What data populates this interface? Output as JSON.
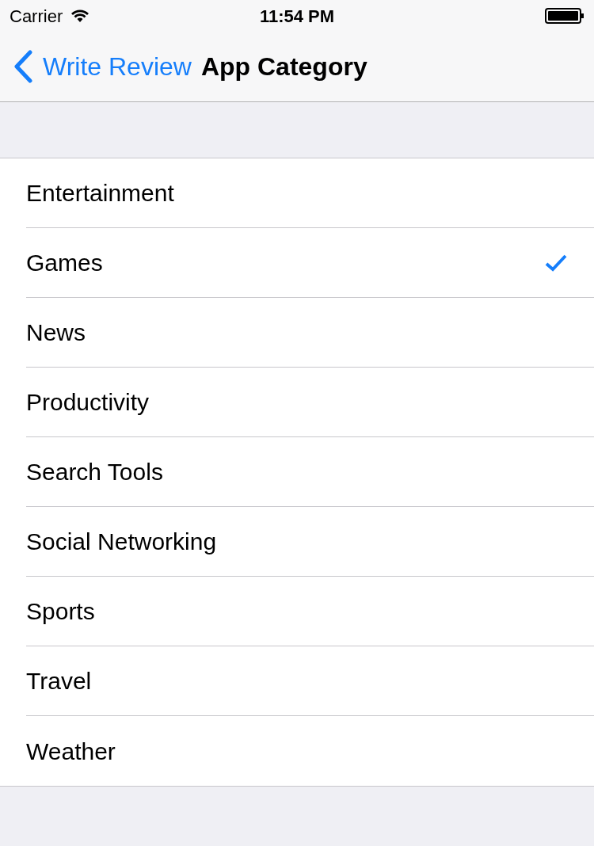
{
  "status_bar": {
    "carrier": "Carrier",
    "time": "11:54 PM"
  },
  "nav_bar": {
    "back": "Write Review",
    "title": "App Category"
  },
  "categories": [
    {
      "label": "Entertainment",
      "selected": false
    },
    {
      "label": "Games",
      "selected": true
    },
    {
      "label": "News",
      "selected": false
    },
    {
      "label": "Productivity",
      "selected": false
    },
    {
      "label": "Search Tools",
      "selected": false
    },
    {
      "label": "Social Networking",
      "selected": false
    },
    {
      "label": "Sports",
      "selected": false
    },
    {
      "label": "Travel",
      "selected": false
    },
    {
      "label": "Weather",
      "selected": false
    }
  ]
}
